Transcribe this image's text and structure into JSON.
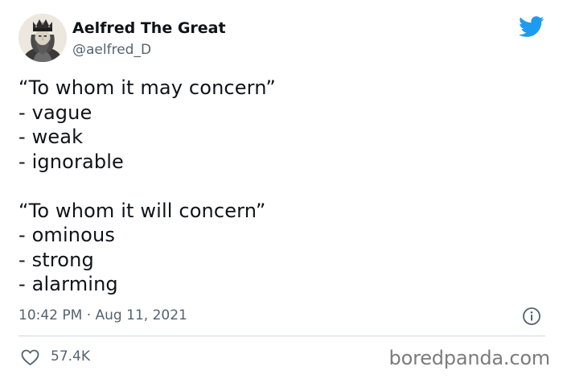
{
  "author": {
    "display_name": "Aelfred The Great",
    "handle": "@aelfred_D",
    "avatar_icon": "king-portrait-avatar"
  },
  "tweet": {
    "lines": [
      "“To whom it may concern”",
      "- vague",
      "- weak",
      "- ignorable",
      "",
      "“To whom it will concern”",
      "- ominous",
      "- strong",
      "- alarming"
    ],
    "timestamp": "10:42 PM · Aug 11, 2021"
  },
  "engagement": {
    "likes": "57.4K"
  },
  "watermark": "boredpanda.com",
  "colors": {
    "twitter_blue": "#1d9bf0",
    "text_primary": "#0f1419",
    "text_secondary": "#536471",
    "divider": "#cfd9de",
    "watermark": "#7c7c7c"
  }
}
